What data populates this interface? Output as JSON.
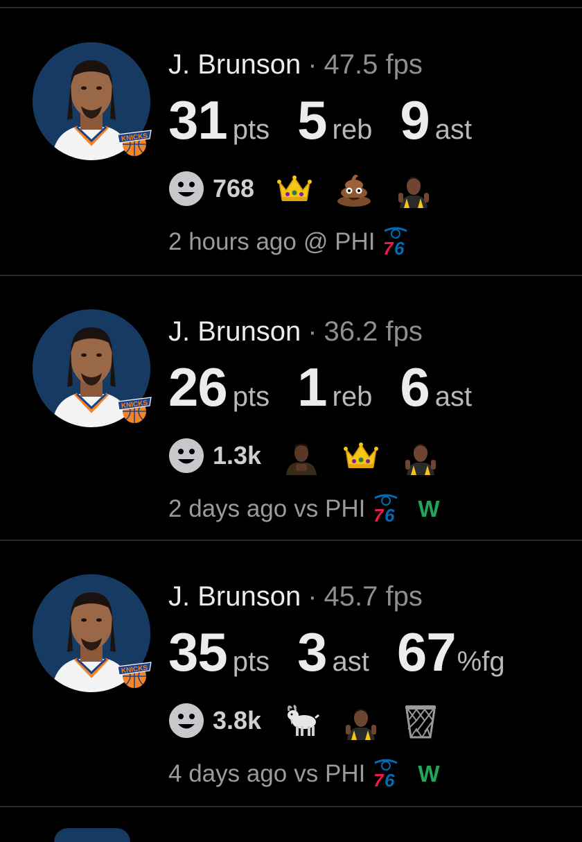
{
  "feed": {
    "items": [
      {
        "player": "J. Brunson",
        "separator": "·",
        "fps": "47.5 fps",
        "stats": [
          {
            "value": "31",
            "unit": "pts"
          },
          {
            "value": "5",
            "unit": "reb"
          },
          {
            "value": "9",
            "unit": "ast"
          }
        ],
        "reaction_count": "768",
        "reactions": [
          "crown-emoji",
          "poop-emoji",
          "player-photo-emoji"
        ],
        "time": "2 hours ago",
        "matchup": "@ PHI",
        "opponent_logo": "76ers-logo",
        "result": ""
      },
      {
        "player": "J. Brunson",
        "separator": "·",
        "fps": "36.2 fps",
        "stats": [
          {
            "value": "26",
            "unit": "pts"
          },
          {
            "value": "1",
            "unit": "reb"
          },
          {
            "value": "6",
            "unit": "ast"
          }
        ],
        "reaction_count": "1.3k",
        "reactions": [
          "player-photo-emoji",
          "crown-emoji",
          "player-photo-emoji"
        ],
        "time": "2 days ago",
        "matchup": "vs PHI",
        "opponent_logo": "76ers-logo",
        "result": "W"
      },
      {
        "player": "J. Brunson",
        "separator": "·",
        "fps": "45.7 fps",
        "stats": [
          {
            "value": "35",
            "unit": "pts"
          },
          {
            "value": "3",
            "unit": "ast"
          },
          {
            "value": "67",
            "unit": "%fg"
          }
        ],
        "reaction_count": "3.8k",
        "reactions": [
          "goat-emoji",
          "player-photo-emoji",
          "basketball-hoop-emoji"
        ],
        "time": "4 days ago",
        "matchup": "vs PHI",
        "opponent_logo": "76ers-logo",
        "result": "W"
      }
    ]
  },
  "colors": {
    "background": "#000000",
    "primary_text": "#ececec",
    "secondary_text": "#8e8e93",
    "win_green": "#22a559",
    "knicks_blue": "#173a63",
    "knicks_orange": "#f58426",
    "sixers_red": "#ed174c",
    "sixers_blue": "#006bb6"
  }
}
